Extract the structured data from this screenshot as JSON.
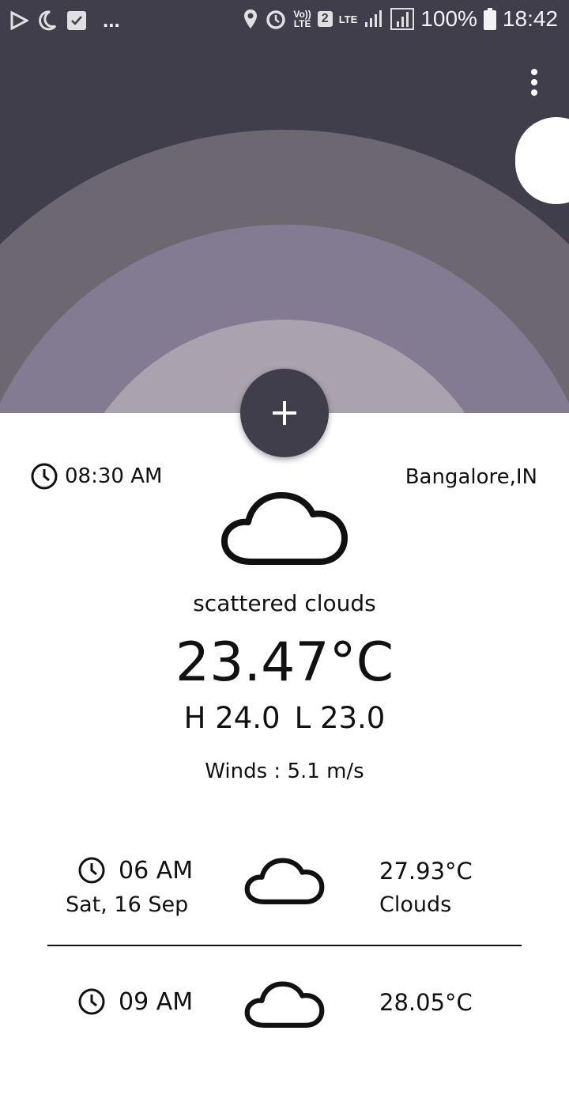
{
  "status_bar": {
    "icons": [
      "play-store-icon",
      "moon-icon",
      "checkbox-icon",
      "more-notifications-icon"
    ],
    "more": "...",
    "volte_line1": "Vo))",
    "volte_line2": "LTE",
    "sim": "2",
    "network": "LTE",
    "battery": "100%",
    "time": "18:42"
  },
  "header": {
    "menu_icon": "overflow-menu-icon",
    "fab_icon": "add-icon",
    "colors": {
      "background": "#403e4b",
      "arc_outer": "#6c6771",
      "arc_middle": "#827b91",
      "arc_inner": "#aaa3ad",
      "sun": "#ffffff"
    }
  },
  "current": {
    "time": "08:30 AM",
    "location": "Bangalore,IN",
    "icon": "cloud-icon",
    "description": "scattered clouds",
    "temperature": "23.47°C",
    "high": "H 24.0",
    "low": "L 23.0",
    "winds": "Winds : 5.1 m/s"
  },
  "forecast": [
    {
      "time": "06 AM",
      "date": "Sat, 16 Sep",
      "icon": "cloud-icon",
      "temp": "27.93°C",
      "condition": "Clouds"
    },
    {
      "time": "09 AM",
      "date": "",
      "icon": "cloud-icon",
      "temp": "28.05°C",
      "condition": ""
    }
  ]
}
